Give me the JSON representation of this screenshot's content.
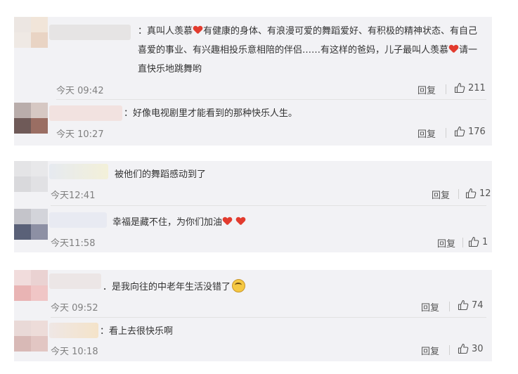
{
  "groups": [
    {
      "comment": {
        "text_parts": [
          {
            "type": "text",
            "value": "：真叫人羡慕"
          },
          {
            "type": "heart"
          },
          {
            "type": "text",
            "value": "有健康的身体、有浪漫可爱的舞蹈爱好、有积极的精神状态、有自己喜爱的事业、有兴趣相投乐意相陪的伴侣……有这样的爸妈，儿子最叫人羡慕"
          },
          {
            "type": "heart"
          },
          {
            "type": "text",
            "value": "请一直快乐地跳舞哟"
          }
        ],
        "time": "今天 09:42",
        "reply_label": "回复",
        "likes": "211"
      },
      "reply": {
        "text": "：好像电视剧里才能看到的那种快乐人生。",
        "time": "今天 10:27",
        "reply_label": "回复",
        "likes": "176"
      }
    },
    {
      "comment": {
        "text": "被他们的舞蹈感动到了",
        "time": "今天12:41",
        "reply_label": "回复",
        "likes": "12"
      },
      "reply": {
        "text": "幸福是藏不住，为你们加油",
        "time": "今天11:58",
        "reply_label": "回复",
        "likes": "1"
      }
    },
    {
      "comment": {
        "text": "．是我向往的中老年生活没错了",
        "time": "今天 09:52",
        "reply_label": "回复",
        "likes": "74"
      },
      "reply": {
        "text": "：看上去很快乐啊",
        "time": "今天 10:18",
        "reply_label": "回复",
        "likes": "30"
      }
    }
  ],
  "icons": {
    "like": "thumbs-up-icon",
    "heart": "red-heart-emoji",
    "laugh": "laughing-emoji"
  },
  "colors": {
    "panel_bg": "#f2f2f5",
    "text": "#333333",
    "muted": "#808080",
    "heart": "#e23b2e"
  }
}
